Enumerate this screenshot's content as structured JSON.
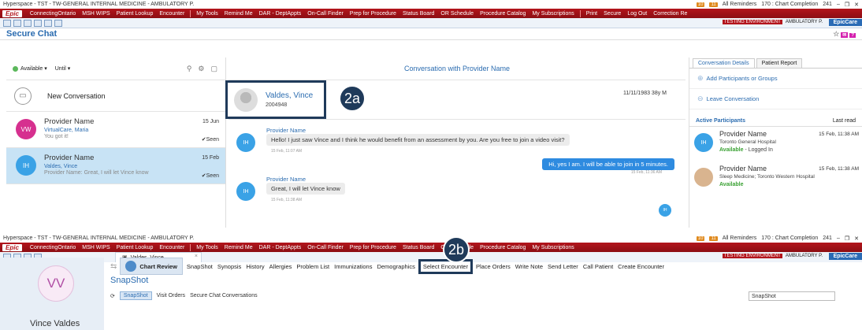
{
  "top": {
    "window_title": "Hyperspace - TST - TW-GENERAL INTERNAL MEDICINE - AMBULATORY P.",
    "badge1": "10",
    "badge2": "11",
    "reminders": "All Reminders",
    "chart_completion": "170 : Chart Completion",
    "count": "241",
    "epic_label": "Epic",
    "epic_menu": [
      "ConnectingOntario",
      "MSH WIPS",
      "Patient Lookup",
      "Encounter",
      "My Tools",
      "Remind Me",
      "DAR - DeptAppts",
      "On-Call Finder",
      "Prep for Procedure",
      "Status Board",
      "OR Schedule",
      "Procedure Catalog",
      "My Subscriptions"
    ],
    "right_menu": [
      "Print",
      "Secure",
      "Log Out",
      "Correction Re"
    ],
    "testing_env": "TESTING ENVIRONMENT",
    "location": "AMBULATORY P.",
    "epiccare": "EpicCare"
  },
  "page_title": "Secure Chat",
  "left": {
    "status": "Available",
    "until": "Until",
    "new_conversation": "New Conversation",
    "conversations": [
      {
        "initials": "VW",
        "name": "Provider Name",
        "sub": "VirtualCare, Maria",
        "msg": "You got it!",
        "date": "15 Jun",
        "seen": "Seen",
        "color": "#d6308f"
      },
      {
        "initials": "IH",
        "name": "Provider Name",
        "sub": "Valdes, Vince",
        "msg": "Provider Name: Great, I will let Vince know",
        "date": "15 Feb",
        "seen": "Seen",
        "color": "#3aa2e6"
      }
    ]
  },
  "mid": {
    "header_prefix": "Conversation with",
    "header_name": "Provider Name",
    "patient_name": "Valdes, Vince",
    "patient_id": "2004948",
    "patient_dob": "11/11/1983 38y M",
    "callout_a": "2a",
    "messages": [
      {
        "initials": "IH",
        "sender": "Provider Name",
        "text": "Hello! I just saw Vince and I think he would benefit from an assessment by you. Are you free to join a video visit?",
        "time": "15 Feb, 11:07 AM"
      },
      {
        "initials": "IH",
        "sender": "Provider Name",
        "text": "Great, I will let Vince know",
        "time": "15 Feb, 11:38 AM"
      }
    ],
    "outgoing": {
      "text": "Hi, yes I am. I will be able to join in 5 minutes.",
      "time": "15 Feb, 11:36 AM"
    },
    "typing_initials": "IH"
  },
  "right": {
    "tabs": [
      "Conversation Details",
      "Patient Report"
    ],
    "add_participants": "Add Participants or Groups",
    "leave": "Leave Conversation",
    "active_participants": "Active Participants",
    "last_read": "Last read",
    "participants": [
      {
        "initials": "IH",
        "name": "Provider Name",
        "org": "Toronto General Hospital",
        "status": "Available",
        "status_extra": " - Logged In",
        "date": "15 Feb, 11:38 AM"
      },
      {
        "initials": "",
        "name": "Provider Name",
        "org": "Sleep Medicine; Toronto Western Hospital",
        "status": "Available",
        "status_extra": "",
        "date": "15 Feb, 11:38 AM"
      }
    ]
  },
  "sec2": {
    "patient_tab": "Valdes, Vince",
    "avatar": "VV",
    "patient_name": "Vince Valdes",
    "callout_b": "2b",
    "actions": [
      "Chart Review",
      "SnapShot",
      "Synopsis",
      "History",
      "Allergies",
      "Problem List",
      "Immunizations",
      "Demographics",
      "Select Encounter",
      "Place Orders",
      "Write Note",
      "Send Letter",
      "Call Patient",
      "Create Encounter"
    ],
    "snapshot_title": "SnapShot",
    "sub_actions": [
      "SnapShot",
      "Visit Orders",
      "Secure Chat Conversations"
    ],
    "search_value": "SnapShot"
  }
}
